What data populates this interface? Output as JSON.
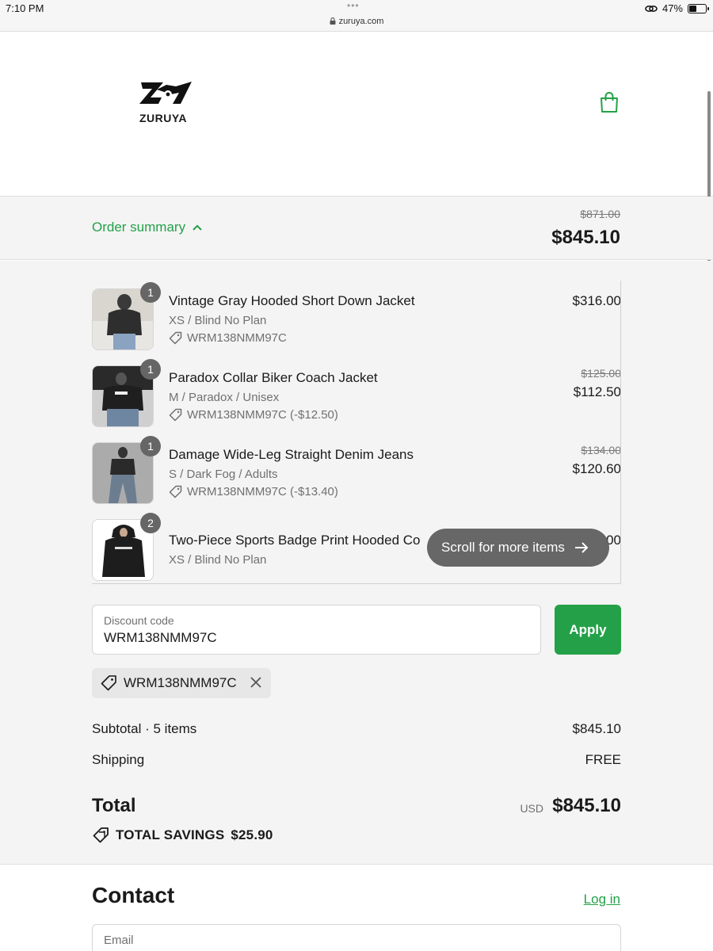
{
  "status_bar": {
    "time": "7:10 PM",
    "url": "zuruya.com",
    "battery": "47%",
    "battery_level": 0.47
  },
  "header": {
    "brand": "ZURUYA"
  },
  "summary_bar": {
    "toggle_label": "Order summary",
    "original_total": "$871.00",
    "total": "$845.10"
  },
  "items": [
    {
      "qty": "1",
      "name": "Vintage Gray Hooded Short Down Jacket",
      "variant": "XS / Blind No Plan",
      "discount": "WRM138NMM97C",
      "price": "$316.00"
    },
    {
      "qty": "1",
      "name": "Paradox Collar Biker Coach Jacket",
      "variant": "M / Paradox / Unisex",
      "discount": "WRM138NMM97C (-$12.50)",
      "old_price": "$125.00",
      "price": "$112.50"
    },
    {
      "qty": "1",
      "name": "Damage Wide-Leg Straight Denim Jeans",
      "variant": "S / Dark Fog / Adults",
      "discount": "WRM138NMM97C (-$13.40)",
      "old_price": "$134.00",
      "price": "$120.60"
    },
    {
      "qty": "2",
      "name": "Two-Piece Sports Badge Print Hooded Co",
      "variant": "XS / Blind No Plan",
      "price": "00"
    }
  ],
  "scroll_hint": "Scroll for more items",
  "discount_field": {
    "label": "Discount code",
    "value": "WRM138NMM97C",
    "apply_label": "Apply"
  },
  "applied_code": "WRM138NMM97C",
  "totals": {
    "subtotal_label": "Subtotal · 5 items",
    "subtotal": "$845.10",
    "shipping_label": "Shipping",
    "shipping": "FREE",
    "total_label": "Total",
    "currency": "USD",
    "total": "$845.10",
    "savings_label": "TOTAL SAVINGS",
    "savings": "$25.90"
  },
  "contact": {
    "title": "Contact",
    "login": "Log in",
    "email_placeholder": "Email"
  },
  "colors": {
    "accent": "#24a148",
    "panel_bg": "#f4f4f4"
  }
}
